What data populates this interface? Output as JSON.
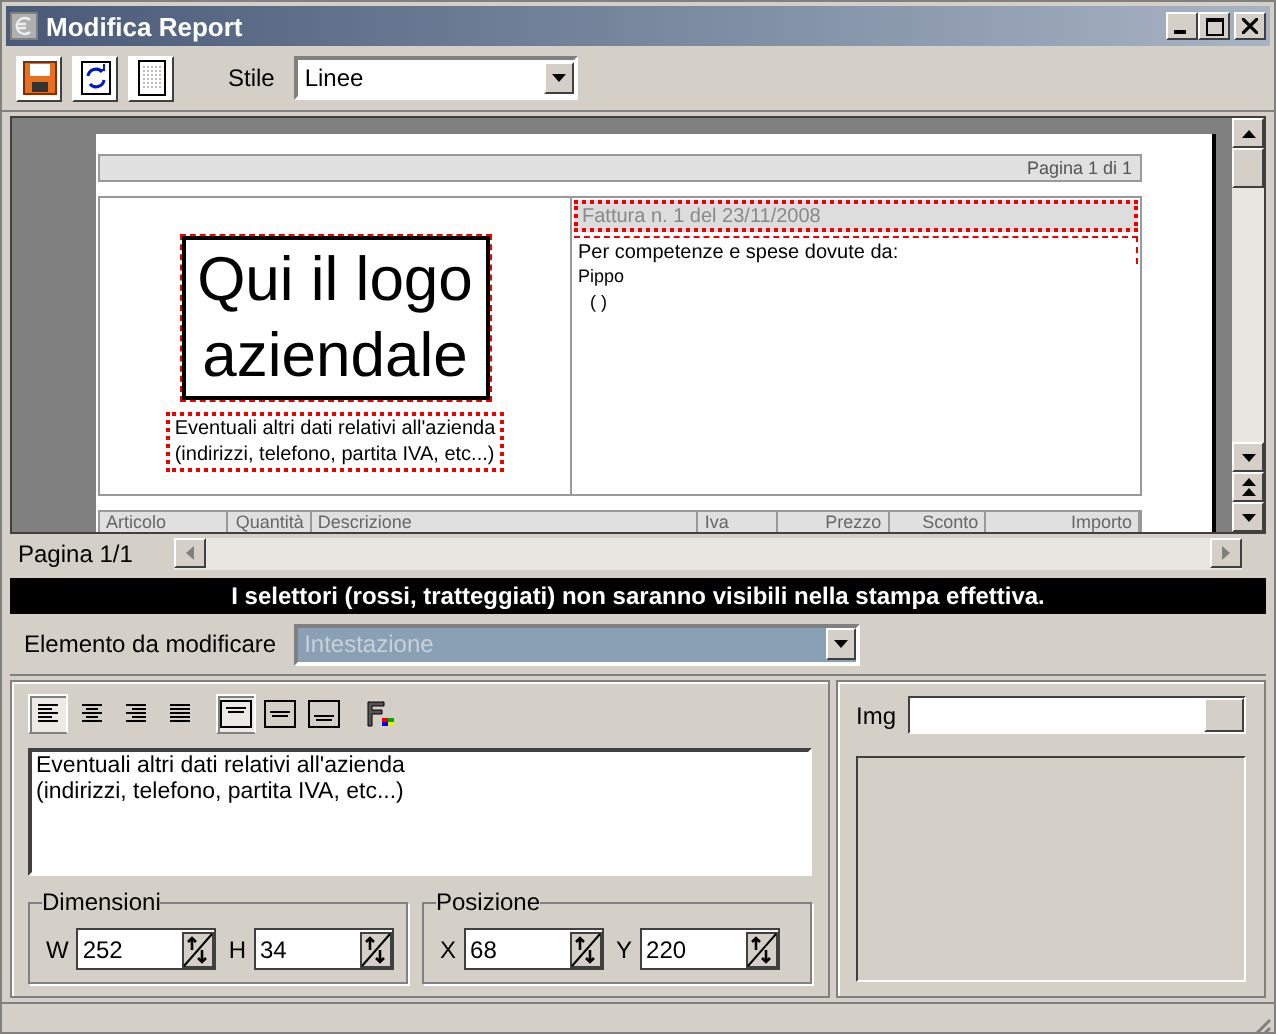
{
  "window": {
    "title": "Modifica Report"
  },
  "toolbar": {
    "buttons": [
      {
        "kind": "save",
        "selected": false
      },
      {
        "kind": "refresh",
        "selected": false
      },
      {
        "kind": "page",
        "selected": false
      }
    ],
    "style_label": "Stile",
    "style_value": "Linee"
  },
  "preview": {
    "page_header": "Pagina  1  di  1",
    "logo_lines": [
      "Qui il logo",
      "aziendale"
    ],
    "company_info": [
      "Eventuali altri dati relativi all'azienda",
      "(indirizzi, telefono, partita IVA, etc...)"
    ],
    "invoice_title": "Fattura  n.  1  del  23/11/2008",
    "recipient_label": "Per competenze e spese dovute da:",
    "recipient_name": "Pippo",
    "recipient_extra": "( )",
    "table_columns": [
      "Articolo",
      "Quantità",
      "Descrizione",
      "Iva",
      "Prezzo",
      "Sconto",
      "Importo"
    ]
  },
  "page_indicator": "Pagina 1/1",
  "notice": "I selettori (rossi, tratteggiati) non saranno visibili nella stampa effettiva.",
  "element": {
    "label": "Elemento da modificare",
    "value": "Intestazione"
  },
  "format_buttons": [
    {
      "kind": "align-left",
      "selected": true
    },
    {
      "kind": "align-center",
      "selected": false
    },
    {
      "kind": "align-right",
      "selected": false
    },
    {
      "kind": "justify",
      "selected": false
    },
    {
      "kind": "valign-top",
      "selected": true
    },
    {
      "kind": "valign-middle",
      "selected": false
    },
    {
      "kind": "valign-bottom",
      "selected": false
    },
    {
      "kind": "font",
      "selected": false
    }
  ],
  "text_value": "Eventuali altri dati relativi all'azienda\n(indirizzi, telefono, partita IVA, etc...)",
  "groups": [
    {
      "title": "Dimensioni",
      "fields": [
        {
          "label": "W",
          "value": "252"
        },
        {
          "label": "H",
          "value": "34"
        }
      ]
    },
    {
      "title": "Posizione",
      "fields": [
        {
          "label": "X",
          "value": "68"
        },
        {
          "label": "Y",
          "value": "220"
        }
      ]
    }
  ],
  "image": {
    "label": "Img"
  }
}
